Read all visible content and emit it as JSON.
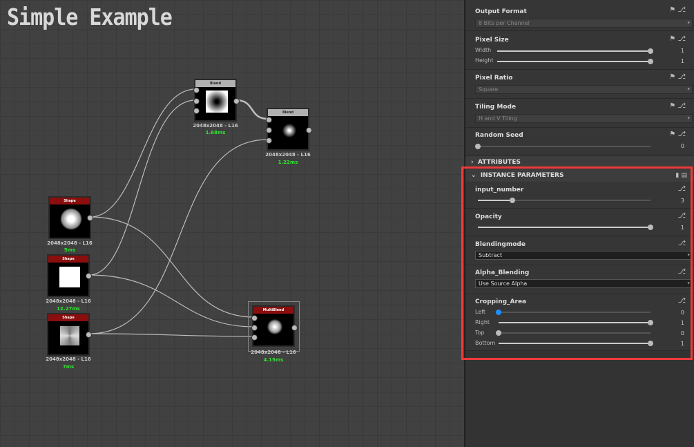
{
  "canvas": {
    "title": "Simple Example",
    "nodes": [
      {
        "id": "blend1",
        "title": "Blend",
        "res": "2048x2048 - L16",
        "time": "1.68ms"
      },
      {
        "id": "blend2",
        "title": "Blend",
        "res": "2048x2048 - L16",
        "time": "1.22ms"
      },
      {
        "id": "shape1",
        "title": "Shape",
        "res": "2048x2048 - L16",
        "time": "5ms"
      },
      {
        "id": "shape2",
        "title": "Shape",
        "res": "2048x2048 - L16",
        "time": "12.27ms"
      },
      {
        "id": "shape3",
        "title": "Shape",
        "res": "2048x2048 - L16",
        "time": "7ms"
      },
      {
        "id": "multiblend",
        "title": "MultiBlend",
        "res": "2048x2048 - L16",
        "time": "4.15ms"
      }
    ]
  },
  "panel": {
    "output_format": {
      "label": "Output Format",
      "value": "8 Bits per Channel"
    },
    "pixel_size": {
      "label": "Pixel Size",
      "width_label": "Width",
      "width": "1",
      "height_label": "Height",
      "height": "1"
    },
    "pixel_ratio": {
      "label": "Pixel Ratio",
      "value": "Square"
    },
    "tiling_mode": {
      "label": "Tiling Mode",
      "value": "H and V Tiling"
    },
    "random_seed": {
      "label": "Random Seed",
      "value": "0"
    },
    "attributes": "ATTRIBUTES",
    "instance": {
      "title": "INSTANCE PARAMETERS",
      "input_number": {
        "label": "input_number",
        "value": "3",
        "fraction": 0.2
      },
      "opacity": {
        "label": "Opacity",
        "value": "1",
        "fraction": 1
      },
      "blendingmode": {
        "label": "Blendingmode",
        "value": "Subtract"
      },
      "alpha_blending": {
        "label": "Alpha_Blending",
        "value": "Use Source Alpha"
      },
      "cropping": {
        "label": "Cropping_Area",
        "left_label": "Left",
        "left": "0",
        "right_label": "Right",
        "right": "1",
        "top_label": "Top",
        "top": "0",
        "bottom_label": "Bottom",
        "bottom": "1"
      }
    }
  },
  "colors": {
    "highlight": "#f03a3a",
    "shape_header": "#8b0e0e",
    "blend_header": "#b0b0b0",
    "time": "#2ee82e",
    "active_knob": "#1e8fff"
  }
}
